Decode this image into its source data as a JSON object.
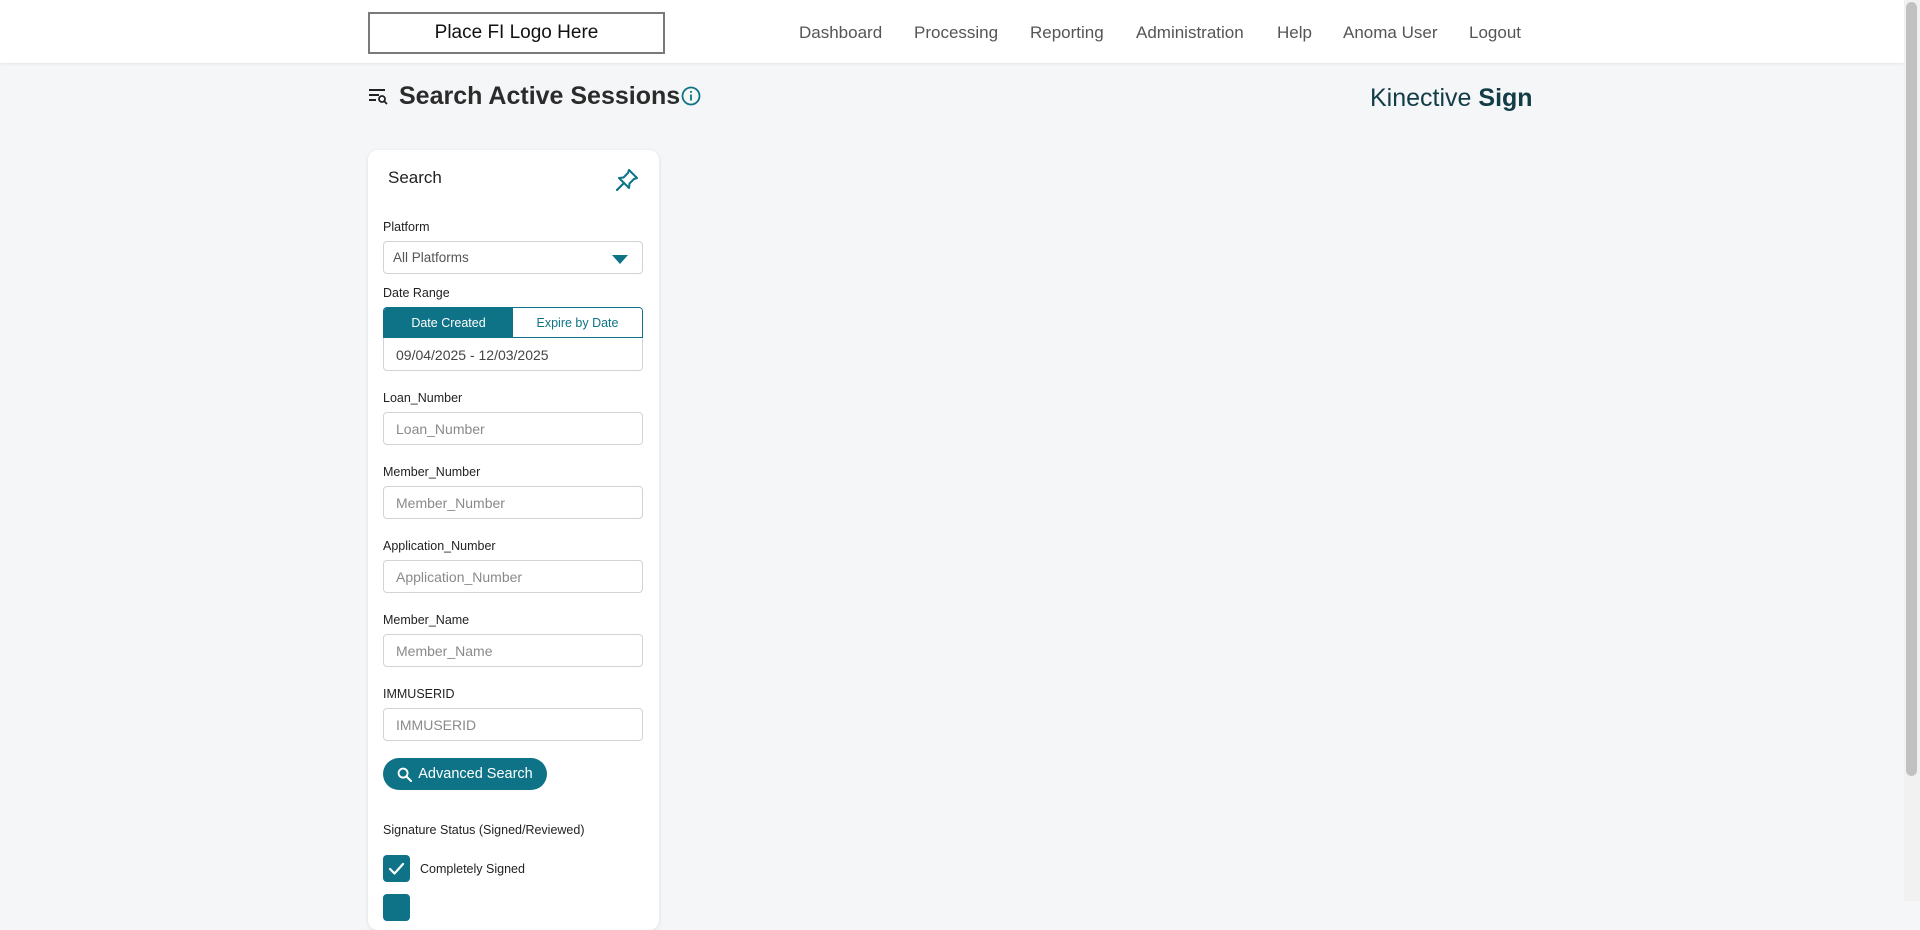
{
  "header": {
    "logo_text": "Place FI Logo Here",
    "nav": {
      "dashboard": "Dashboard",
      "processing": "Processing",
      "reporting": "Reporting",
      "administration": "Administration",
      "help": "Help",
      "user": "Anoma User",
      "logout": "Logout"
    }
  },
  "page": {
    "title": "Search Active Sessions",
    "brand_light": "Kinective",
    "brand_bold": "Sign"
  },
  "search_panel": {
    "title": "Search",
    "platform": {
      "label": "Platform",
      "value": "All Platforms"
    },
    "date_range": {
      "label": "Date Range",
      "option_created": "Date Created",
      "option_expire": "Expire by Date",
      "selected": "Date Created",
      "value": "09/04/2025 - 12/03/2025"
    },
    "loan_number": {
      "label": "Loan_Number",
      "placeholder": "Loan_Number"
    },
    "member_number": {
      "label": "Member_Number",
      "placeholder": "Member_Number"
    },
    "application_number": {
      "label": "Application_Number",
      "placeholder": "Application_Number"
    },
    "member_name": {
      "label": "Member_Name",
      "placeholder": "Member_Name"
    },
    "immuserid": {
      "label": "IMMUSERID",
      "placeholder": "IMMUSERID"
    },
    "advanced_search_label": "Advanced Search",
    "signature_status": {
      "label": "Signature Status (Signed/Reviewed)",
      "completely_signed": "Completely Signed",
      "completely_signed_checked": true
    }
  },
  "colors": {
    "accent": "#0e7386",
    "brand_text": "#123c46",
    "background": "#f4f6f8"
  }
}
